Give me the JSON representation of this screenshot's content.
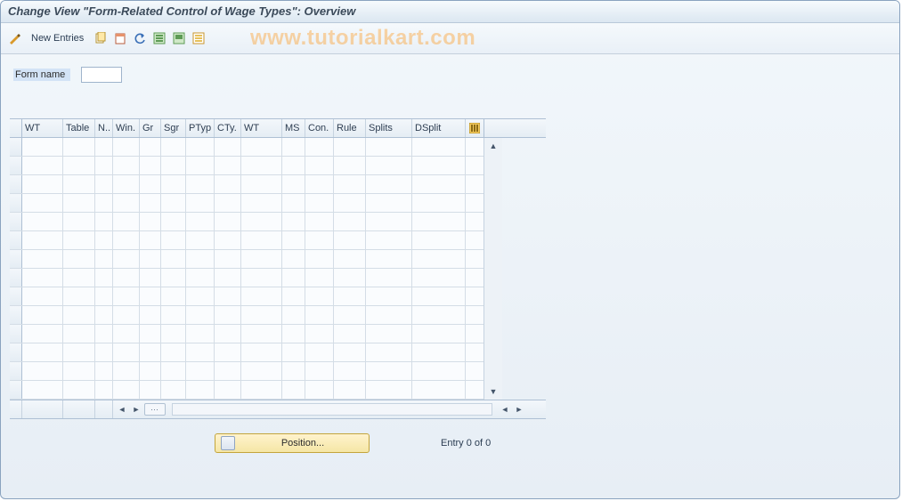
{
  "title": "Change View \"Form-Related Control of Wage Types\": Overview",
  "watermark": "www.tutorialkart.com",
  "toolbar": {
    "new_entries": "New Entries"
  },
  "form": {
    "label": "Form name",
    "value": ""
  },
  "columns": [
    {
      "key": "wt",
      "label": "WT",
      "w": 46
    },
    {
      "key": "table",
      "label": "Table",
      "w": 36
    },
    {
      "key": "n",
      "label": "N..",
      "w": 20
    },
    {
      "key": "win",
      "label": "Win.",
      "w": 30
    },
    {
      "key": "gr",
      "label": "Gr",
      "w": 24
    },
    {
      "key": "sgr",
      "label": "Sgr",
      "w": 28
    },
    {
      "key": "ptyp",
      "label": "PTyp",
      "w": 32
    },
    {
      "key": "cty",
      "label": "CTy.",
      "w": 30
    },
    {
      "key": "wt2",
      "label": "WT",
      "w": 46
    },
    {
      "key": "ms",
      "label": "MS",
      "w": 26
    },
    {
      "key": "con",
      "label": "Con.",
      "w": 32
    },
    {
      "key": "rule",
      "label": "Rule",
      "w": 36
    },
    {
      "key": "splits",
      "label": "Splits",
      "w": 52
    },
    {
      "key": "dsplit",
      "label": "DSplit",
      "w": 60
    }
  ],
  "row_count": 14,
  "footer": {
    "position_label": "Position...",
    "entry_text": "Entry 0 of 0"
  }
}
